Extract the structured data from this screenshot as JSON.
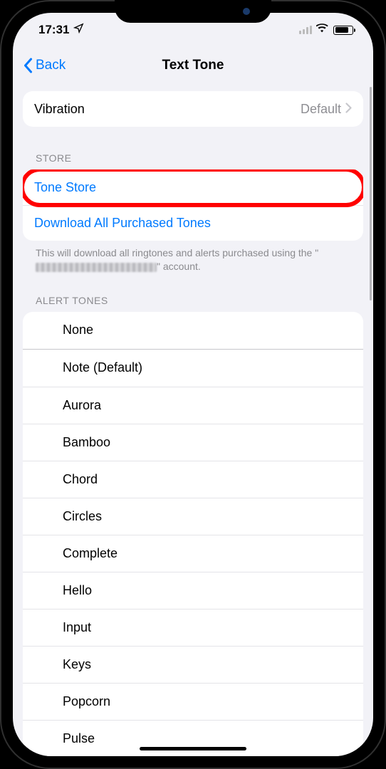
{
  "status": {
    "time": "17:31"
  },
  "nav": {
    "back": "Back",
    "title": "Text Tone"
  },
  "vibration": {
    "label": "Vibration",
    "value": "Default"
  },
  "store": {
    "header": "STORE",
    "toneStore": "Tone Store",
    "downloadAll": "Download All Purchased Tones",
    "footerPrefix": "This will download all ringtones and alerts purchased using the \"",
    "footerSuffix": "\" account."
  },
  "alertTones": {
    "header": "ALERT TONES",
    "items": [
      "None",
      "Note (Default)",
      "Aurora",
      "Bamboo",
      "Chord",
      "Circles",
      "Complete",
      "Hello",
      "Input",
      "Keys",
      "Popcorn",
      "Pulse"
    ]
  }
}
